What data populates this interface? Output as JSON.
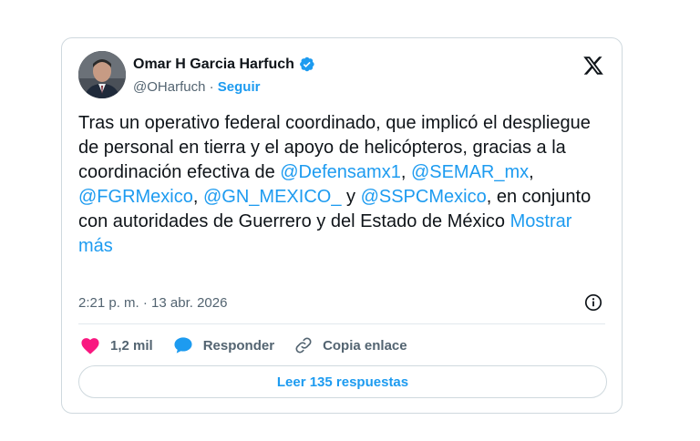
{
  "author": {
    "name": "Omar H Garcia Harfuch",
    "handle": "@OHarfuch",
    "separator": "·",
    "follow_label": "Seguir"
  },
  "tweet": {
    "parts": [
      {
        "text": "Tras un operativo federal coordinado, que implicó el despliegue de personal en tierra y el apoyo de helicópteros,  gracias a la coordinación efectiva de ",
        "type": "text"
      },
      {
        "text": "@Defensamx1",
        "type": "mention"
      },
      {
        "text": ", ",
        "type": "text"
      },
      {
        "text": "@SEMAR_mx",
        "type": "mention"
      },
      {
        "text": ", ",
        "type": "text"
      },
      {
        "text": "@FGRMexico",
        "type": "mention"
      },
      {
        "text": ", ",
        "type": "text"
      },
      {
        "text": "@GN_MEXICO_",
        "type": "mention"
      },
      {
        "text": " y ",
        "type": "text"
      },
      {
        "text": "@SSPCMexico",
        "type": "mention"
      },
      {
        "text": ", en conjunto con autoridades de Guerrero y del Estado de México ",
        "type": "text"
      }
    ],
    "show_more": "Mostrar más",
    "timestamp": "2:21 p. m. · 13 abr. 2026"
  },
  "actions": {
    "likes": "1,2 mil",
    "reply": "Responder",
    "copy_link": "Copia enlace"
  },
  "read_replies": "Leer 135 respuestas",
  "colors": {
    "accent": "#1d9bf0",
    "heart": "#f91880",
    "text": "#0f1419",
    "muted": "#536471",
    "border": "#cfd9de"
  },
  "icons": [
    "verified-badge-icon",
    "x-logo-icon",
    "info-icon",
    "heart-icon",
    "reply-bubble-icon",
    "link-icon"
  ]
}
